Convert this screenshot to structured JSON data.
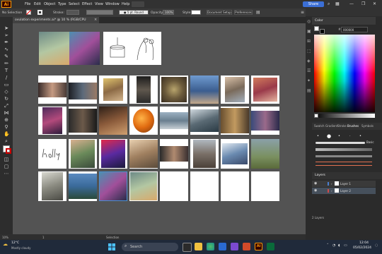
{
  "menubar": {
    "app_logo": "Ai",
    "items": [
      "File",
      "Edit",
      "Object",
      "Type",
      "Select",
      "Effect",
      "View",
      "Window",
      "Help"
    ],
    "share_label": "Share"
  },
  "control_bar": {
    "selection": "No Selection",
    "stroke_label": "Stroke:",
    "brush_size": "5 pt. Round",
    "opacity_label": "Opacity:",
    "opacity_value": "100%",
    "style_label": "Style:",
    "document_setup": "Document Setup",
    "preferences": "Preferences"
  },
  "document_tab": {
    "title": "ovulation experiments.ai* @ 10 % (RGB/CPU Preview)"
  },
  "status_bar": {
    "zoom": "10%",
    "page": "1",
    "tool": "Selection"
  },
  "color_panel": {
    "title": "Color",
    "hex_value": "000000"
  },
  "brushes_panel": {
    "tabs": [
      "Swatch",
      "Gradient",
      "Stroke",
      "Brushes",
      "Symbols"
    ],
    "active_tab": "Brushes",
    "basic_label": "Basic"
  },
  "layers_panel": {
    "title": "Layers",
    "layers": [
      {
        "name": "Layer 1"
      },
      {
        "name": "Layer 2"
      }
    ],
    "footer": "2 Layers"
  },
  "taskbar": {
    "weather_temp": "12°C",
    "weather_desc": "Mostly cloudy",
    "search_placeholder": "Search",
    "time": "12:04",
    "date": "05/02/2024"
  }
}
